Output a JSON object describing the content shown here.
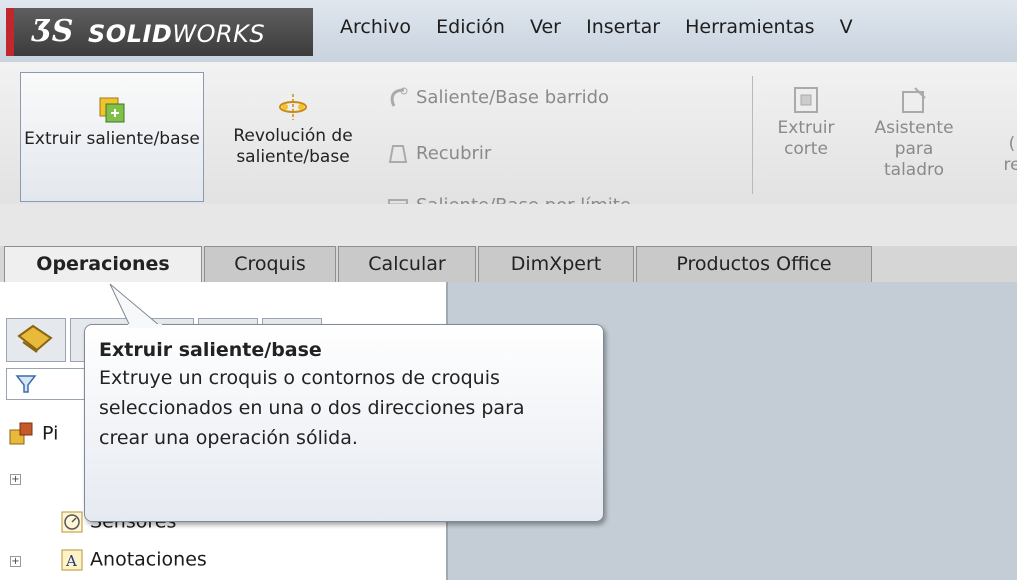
{
  "app": {
    "logo_mark": "ƷS",
    "name_bold": "SOLID",
    "name_rest": "WORKS"
  },
  "menu": [
    "Archivo",
    "Edición",
    "Ver",
    "Insertar",
    "Herramientas",
    "V"
  ],
  "ribbon": {
    "extrude_boss": "Extruir saliente/base",
    "revolve_boss": "Revolución de saliente/base",
    "swept_boss": "Saliente/Base barrido",
    "loft": "Recubrir",
    "boundary_boss": "Saliente/Base por límite",
    "extruded_cut": "Extruir corte",
    "hole_wizard": "Asistente para taladro",
    "partial_next": "(",
    "partial_next_line2": "re"
  },
  "tabs": [
    "Operaciones",
    "Croquis",
    "Calcular",
    "DimXpert",
    "Productos Office"
  ],
  "tree": {
    "part_label": "Pi",
    "sensors": "Sensores",
    "annotations": "Anotaciones"
  },
  "tooltip": {
    "title": "Extruir saliente/base",
    "body": "Extruye un croquis o contornos de croquis seleccionados en una o dos direcciones para crear una operación sólida."
  },
  "colors": {
    "brand_red": "#c0282d",
    "brand_dark": "#4a4a4a",
    "graphics_area": "#c4cdd5"
  }
}
